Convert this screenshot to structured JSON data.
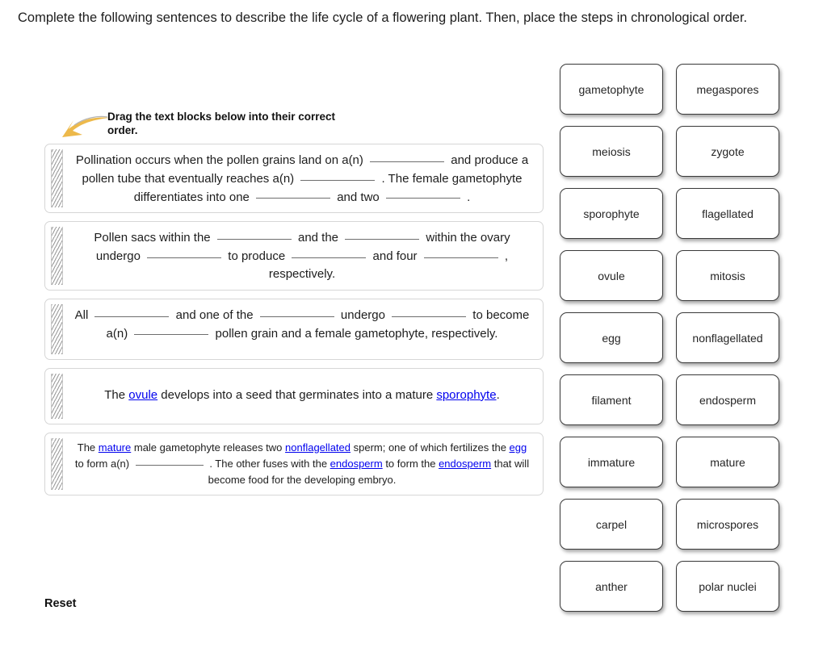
{
  "prompt": "Complete the following sentences to describe the life cycle of a flowering plant. Then, place the steps in chronological order.",
  "drag_hint": {
    "text": "Drag the text blocks below into their correct order.",
    "arrow_color": "#edb94b"
  },
  "reset_label": "Reset",
  "colors": {
    "answer_link": "#0000ee",
    "block_border": "#d6d6d6",
    "tile_border": "#3a3a3a",
    "blank_rule": "#6e6e6e"
  },
  "blocks": [
    {
      "id": "block-1",
      "parts": [
        {
          "t": "text",
          "v": "Pollination occurs when the pollen grains land on a(n) "
        },
        {
          "t": "blank"
        },
        {
          "t": "text",
          "v": " and produce a pollen tube that eventually reaches a(n) "
        },
        {
          "t": "blank"
        },
        {
          "t": "text",
          "v": " . The female gametophyte differentiates into one "
        },
        {
          "t": "blank"
        },
        {
          "t": "text",
          "v": " and two "
        },
        {
          "t": "blank"
        },
        {
          "t": "text",
          "v": " ."
        }
      ]
    },
    {
      "id": "block-2",
      "parts": [
        {
          "t": "text",
          "v": "Pollen sacs within the "
        },
        {
          "t": "blank"
        },
        {
          "t": "text",
          "v": " and the "
        },
        {
          "t": "blank"
        },
        {
          "t": "text",
          "v": " within the ovary undergo "
        },
        {
          "t": "blank"
        },
        {
          "t": "text",
          "v": " to produce "
        },
        {
          "t": "blank"
        },
        {
          "t": "text",
          "v": " and four "
        },
        {
          "t": "blank"
        },
        {
          "t": "text",
          "v": " , respectively."
        }
      ]
    },
    {
      "id": "block-3",
      "parts": [
        {
          "t": "text",
          "v": "All "
        },
        {
          "t": "blank"
        },
        {
          "t": "text",
          "v": " and one of the "
        },
        {
          "t": "blank"
        },
        {
          "t": "text",
          "v": " undergo "
        },
        {
          "t": "blank"
        },
        {
          "t": "text",
          "v": " to become a(n) "
        },
        {
          "t": "blank"
        },
        {
          "t": "text",
          "v": " pollen grain and a female gametophyte, respectively."
        }
      ]
    },
    {
      "id": "block-4",
      "parts": [
        {
          "t": "text",
          "v": "The "
        },
        {
          "t": "answer",
          "v": "ovule"
        },
        {
          "t": "text",
          "v": " develops into a seed that germinates into a mature "
        },
        {
          "t": "answer",
          "v": "sporophyte"
        },
        {
          "t": "text",
          "v": "."
        }
      ]
    },
    {
      "id": "block-5",
      "small": true,
      "parts": [
        {
          "t": "text",
          "v": "The "
        },
        {
          "t": "answer",
          "v": "mature"
        },
        {
          "t": "text",
          "v": " male gametophyte releases two "
        },
        {
          "t": "answer",
          "v": "nonflagellated"
        },
        {
          "t": "text",
          "v": " sperm; one of which fertilizes the "
        },
        {
          "t": "answer",
          "v": "egg"
        },
        {
          "t": "text",
          "v": " to form a(n) "
        },
        {
          "t": "blank"
        },
        {
          "t": "text",
          "v": " . The other fuses with the "
        },
        {
          "t": "answer",
          "v": "endosperm"
        },
        {
          "t": "text",
          "v": " to form the "
        },
        {
          "t": "answer",
          "v": "endosperm"
        },
        {
          "t": "text",
          "v": " that will become food for the developing embryo."
        }
      ]
    }
  ],
  "word_bank": [
    "gametophyte",
    "megaspores",
    "meiosis",
    "zygote",
    "sporophyte",
    "flagellated",
    "ovule",
    "mitosis",
    "egg",
    "nonflagellated",
    "filament",
    "endosperm",
    "immature",
    "mature",
    "carpel",
    "microspores",
    "anther",
    "polar nuclei"
  ]
}
